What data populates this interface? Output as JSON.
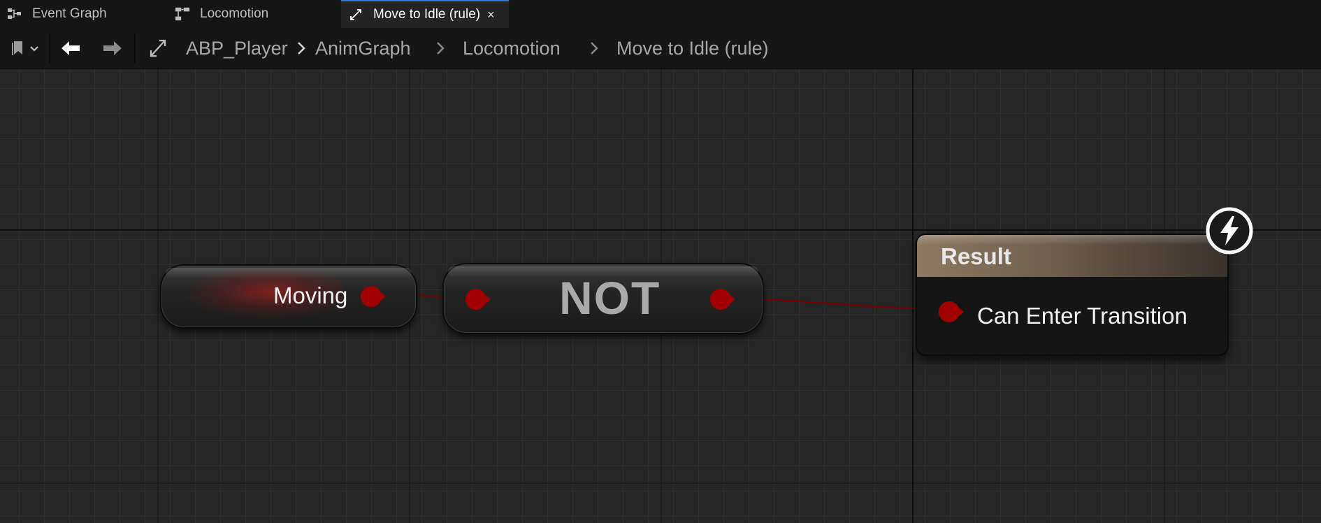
{
  "tabs": [
    {
      "label": "Event Graph",
      "icon": "event-graph-icon",
      "active": false
    },
    {
      "label": "Locomotion",
      "icon": "state-machine-icon",
      "active": false
    },
    {
      "label": "Move to Idle (rule)",
      "icon": "transition-icon",
      "active": true,
      "close": "×"
    }
  ],
  "toolbar": {
    "bookmark_icon": "bookmark-icon",
    "back_icon": "back-arrow-icon",
    "forward_icon": "forward-arrow-icon",
    "transition_icon": "transition-icon",
    "breadcrumbs": [
      "ABP_Player",
      "AnimGraph",
      "Locomotion",
      "Move to Idle (rule)"
    ]
  },
  "graph": {
    "variable_node": {
      "label": "Moving",
      "pin_color": "#a00000"
    },
    "not_node": {
      "label": "NOT"
    },
    "result_node": {
      "title": "Result",
      "pin_label": "Can Enter Transition",
      "badge_icon": "lightning-bolt-icon"
    }
  },
  "colors": {
    "boolean_pin": "#a00000",
    "wire": "#7a0000",
    "result_header": "#8e7a64",
    "canvas": "#262626"
  }
}
